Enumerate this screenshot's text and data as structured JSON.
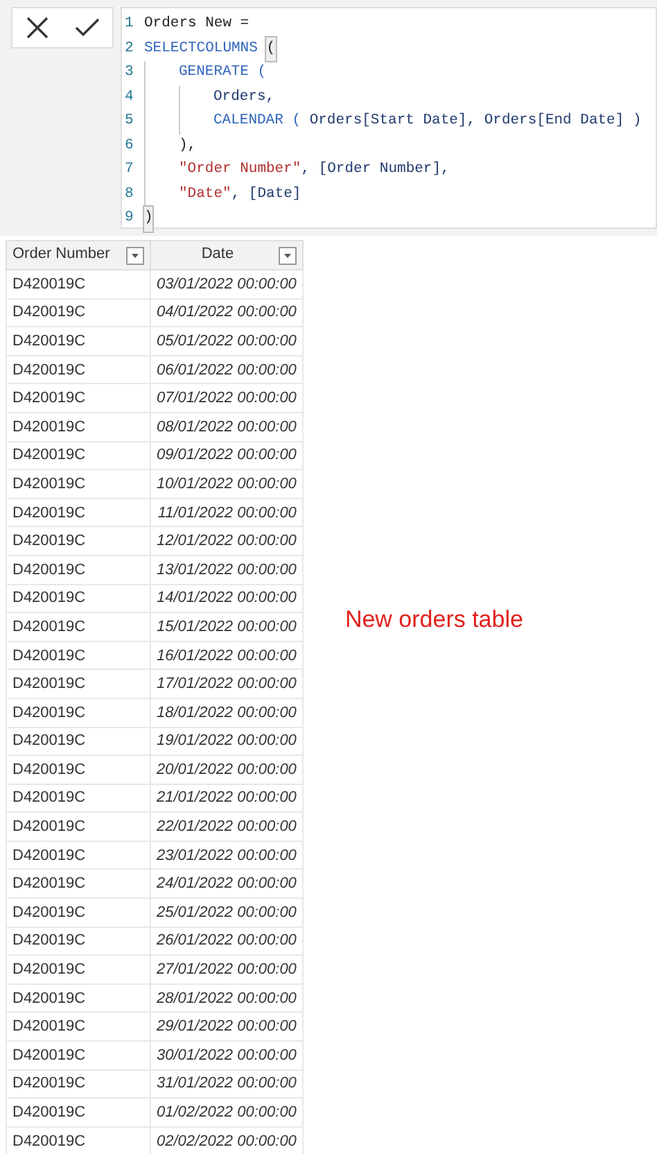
{
  "formula_bar": {
    "code_lines": [
      {
        "number": "1",
        "tokens": [
          {
            "text": "Orders New =",
            "kind": "plain"
          }
        ]
      },
      {
        "number": "2",
        "tokens": [
          {
            "text": "SELECTCOLUMNS ",
            "kind": "keyword"
          },
          {
            "text": "(",
            "kind": "matched_bracket"
          }
        ]
      },
      {
        "number": "3",
        "tokens": [
          {
            "kind": "indent"
          },
          {
            "text": "GENERATE (",
            "kind": "keyword"
          }
        ]
      },
      {
        "number": "4",
        "tokens": [
          {
            "kind": "indent"
          },
          {
            "kind": "indent"
          },
          {
            "text": "Orders,",
            "kind": "column"
          }
        ]
      },
      {
        "number": "5",
        "tokens": [
          {
            "kind": "indent"
          },
          {
            "kind": "indent"
          },
          {
            "text": "CALENDAR (",
            "kind": "keyword"
          },
          {
            "text": " Orders[Start Date], Orders[End Date] )",
            "kind": "column"
          }
        ]
      },
      {
        "number": "6",
        "tokens": [
          {
            "kind": "indent"
          },
          {
            "text": "),",
            "kind": "plain"
          }
        ]
      },
      {
        "number": "7",
        "tokens": [
          {
            "kind": "indent"
          },
          {
            "text": "\"Order Number\"",
            "kind": "string"
          },
          {
            "text": ", [Order Number],",
            "kind": "column"
          }
        ]
      },
      {
        "number": "8",
        "tokens": [
          {
            "kind": "indent"
          },
          {
            "text": "\"Date\"",
            "kind": "string"
          },
          {
            "text": ", [Date]",
            "kind": "column"
          }
        ]
      },
      {
        "number": "9",
        "tokens": [
          {
            "text": ")",
            "kind": "matched_bracket"
          }
        ]
      }
    ]
  },
  "table": {
    "columns": [
      "Order Number",
      "Date"
    ],
    "rows": [
      [
        "D420019C",
        "03/01/2022 00:00:00"
      ],
      [
        "D420019C",
        "04/01/2022 00:00:00"
      ],
      [
        "D420019C",
        "05/01/2022 00:00:00"
      ],
      [
        "D420019C",
        "06/01/2022 00:00:00"
      ],
      [
        "D420019C",
        "07/01/2022 00:00:00"
      ],
      [
        "D420019C",
        "08/01/2022 00:00:00"
      ],
      [
        "D420019C",
        "09/01/2022 00:00:00"
      ],
      [
        "D420019C",
        "10/01/2022 00:00:00"
      ],
      [
        "D420019C",
        "11/01/2022 00:00:00"
      ],
      [
        "D420019C",
        "12/01/2022 00:00:00"
      ],
      [
        "D420019C",
        "13/01/2022 00:00:00"
      ],
      [
        "D420019C",
        "14/01/2022 00:00:00"
      ],
      [
        "D420019C",
        "15/01/2022 00:00:00"
      ],
      [
        "D420019C",
        "16/01/2022 00:00:00"
      ],
      [
        "D420019C",
        "17/01/2022 00:00:00"
      ],
      [
        "D420019C",
        "18/01/2022 00:00:00"
      ],
      [
        "D420019C",
        "19/01/2022 00:00:00"
      ],
      [
        "D420019C",
        "20/01/2022 00:00:00"
      ],
      [
        "D420019C",
        "21/01/2022 00:00:00"
      ],
      [
        "D420019C",
        "22/01/2022 00:00:00"
      ],
      [
        "D420019C",
        "23/01/2022 00:00:00"
      ],
      [
        "D420019C",
        "24/01/2022 00:00:00"
      ],
      [
        "D420019C",
        "25/01/2022 00:00:00"
      ],
      [
        "D420019C",
        "26/01/2022 00:00:00"
      ],
      [
        "D420019C",
        "27/01/2022 00:00:00"
      ],
      [
        "D420019C",
        "28/01/2022 00:00:00"
      ],
      [
        "D420019C",
        "29/01/2022 00:00:00"
      ],
      [
        "D420019C",
        "30/01/2022 00:00:00"
      ],
      [
        "D420019C",
        "31/01/2022 00:00:00"
      ],
      [
        "D420019C",
        "01/02/2022 00:00:00"
      ],
      [
        "D420019C",
        "02/02/2022 00:00:00"
      ]
    ]
  },
  "annotation": "New orders table"
}
